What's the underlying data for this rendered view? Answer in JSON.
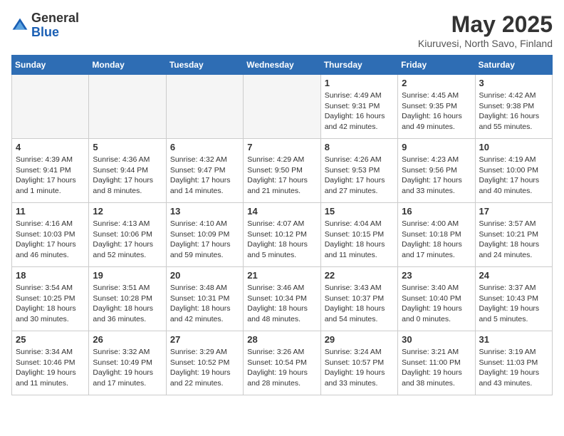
{
  "header": {
    "logo_general": "General",
    "logo_blue": "Blue",
    "month_title": "May 2025",
    "subtitle": "Kiuruvesi, North Savo, Finland"
  },
  "weekdays": [
    "Sunday",
    "Monday",
    "Tuesday",
    "Wednesday",
    "Thursday",
    "Friday",
    "Saturday"
  ],
  "weeks": [
    [
      {
        "day": "",
        "info": ""
      },
      {
        "day": "",
        "info": ""
      },
      {
        "day": "",
        "info": ""
      },
      {
        "day": "",
        "info": ""
      },
      {
        "day": "1",
        "info": "Sunrise: 4:49 AM\nSunset: 9:31 PM\nDaylight: 16 hours\nand 42 minutes."
      },
      {
        "day": "2",
        "info": "Sunrise: 4:45 AM\nSunset: 9:35 PM\nDaylight: 16 hours\nand 49 minutes."
      },
      {
        "day": "3",
        "info": "Sunrise: 4:42 AM\nSunset: 9:38 PM\nDaylight: 16 hours\nand 55 minutes."
      }
    ],
    [
      {
        "day": "4",
        "info": "Sunrise: 4:39 AM\nSunset: 9:41 PM\nDaylight: 17 hours\nand 1 minute."
      },
      {
        "day": "5",
        "info": "Sunrise: 4:36 AM\nSunset: 9:44 PM\nDaylight: 17 hours\nand 8 minutes."
      },
      {
        "day": "6",
        "info": "Sunrise: 4:32 AM\nSunset: 9:47 PM\nDaylight: 17 hours\nand 14 minutes."
      },
      {
        "day": "7",
        "info": "Sunrise: 4:29 AM\nSunset: 9:50 PM\nDaylight: 17 hours\nand 21 minutes."
      },
      {
        "day": "8",
        "info": "Sunrise: 4:26 AM\nSunset: 9:53 PM\nDaylight: 17 hours\nand 27 minutes."
      },
      {
        "day": "9",
        "info": "Sunrise: 4:23 AM\nSunset: 9:56 PM\nDaylight: 17 hours\nand 33 minutes."
      },
      {
        "day": "10",
        "info": "Sunrise: 4:19 AM\nSunset: 10:00 PM\nDaylight: 17 hours\nand 40 minutes."
      }
    ],
    [
      {
        "day": "11",
        "info": "Sunrise: 4:16 AM\nSunset: 10:03 PM\nDaylight: 17 hours\nand 46 minutes."
      },
      {
        "day": "12",
        "info": "Sunrise: 4:13 AM\nSunset: 10:06 PM\nDaylight: 17 hours\nand 52 minutes."
      },
      {
        "day": "13",
        "info": "Sunrise: 4:10 AM\nSunset: 10:09 PM\nDaylight: 17 hours\nand 59 minutes."
      },
      {
        "day": "14",
        "info": "Sunrise: 4:07 AM\nSunset: 10:12 PM\nDaylight: 18 hours\nand 5 minutes."
      },
      {
        "day": "15",
        "info": "Sunrise: 4:04 AM\nSunset: 10:15 PM\nDaylight: 18 hours\nand 11 minutes."
      },
      {
        "day": "16",
        "info": "Sunrise: 4:00 AM\nSunset: 10:18 PM\nDaylight: 18 hours\nand 17 minutes."
      },
      {
        "day": "17",
        "info": "Sunrise: 3:57 AM\nSunset: 10:21 PM\nDaylight: 18 hours\nand 24 minutes."
      }
    ],
    [
      {
        "day": "18",
        "info": "Sunrise: 3:54 AM\nSunset: 10:25 PM\nDaylight: 18 hours\nand 30 minutes."
      },
      {
        "day": "19",
        "info": "Sunrise: 3:51 AM\nSunset: 10:28 PM\nDaylight: 18 hours\nand 36 minutes."
      },
      {
        "day": "20",
        "info": "Sunrise: 3:48 AM\nSunset: 10:31 PM\nDaylight: 18 hours\nand 42 minutes."
      },
      {
        "day": "21",
        "info": "Sunrise: 3:46 AM\nSunset: 10:34 PM\nDaylight: 18 hours\nand 48 minutes."
      },
      {
        "day": "22",
        "info": "Sunrise: 3:43 AM\nSunset: 10:37 PM\nDaylight: 18 hours\nand 54 minutes."
      },
      {
        "day": "23",
        "info": "Sunrise: 3:40 AM\nSunset: 10:40 PM\nDaylight: 19 hours\nand 0 minutes."
      },
      {
        "day": "24",
        "info": "Sunrise: 3:37 AM\nSunset: 10:43 PM\nDaylight: 19 hours\nand 5 minutes."
      }
    ],
    [
      {
        "day": "25",
        "info": "Sunrise: 3:34 AM\nSunset: 10:46 PM\nDaylight: 19 hours\nand 11 minutes."
      },
      {
        "day": "26",
        "info": "Sunrise: 3:32 AM\nSunset: 10:49 PM\nDaylight: 19 hours\nand 17 minutes."
      },
      {
        "day": "27",
        "info": "Sunrise: 3:29 AM\nSunset: 10:52 PM\nDaylight: 19 hours\nand 22 minutes."
      },
      {
        "day": "28",
        "info": "Sunrise: 3:26 AM\nSunset: 10:54 PM\nDaylight: 19 hours\nand 28 minutes."
      },
      {
        "day": "29",
        "info": "Sunrise: 3:24 AM\nSunset: 10:57 PM\nDaylight: 19 hours\nand 33 minutes."
      },
      {
        "day": "30",
        "info": "Sunrise: 3:21 AM\nSunset: 11:00 PM\nDaylight: 19 hours\nand 38 minutes."
      },
      {
        "day": "31",
        "info": "Sunrise: 3:19 AM\nSunset: 11:03 PM\nDaylight: 19 hours\nand 43 minutes."
      }
    ]
  ]
}
